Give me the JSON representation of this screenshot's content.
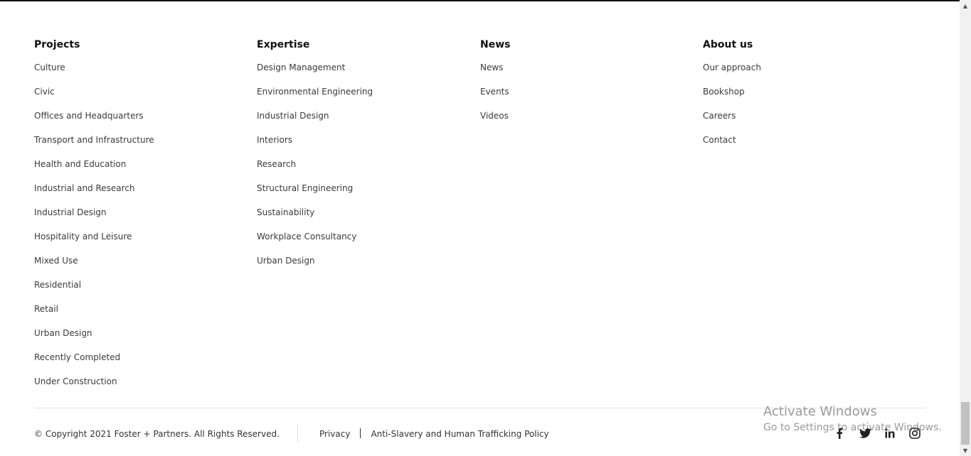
{
  "footer": {
    "columns": [
      {
        "heading": "Projects",
        "links": [
          "Culture",
          "Civic",
          "Offices and Headquarters",
          "Transport and Infrastructure",
          "Health and Education",
          "Industrial and Research",
          "Industrial Design",
          "Hospitality and Leisure",
          "Mixed Use",
          "Residential",
          "Retail",
          "Urban Design",
          "Recently Completed",
          "Under Construction"
        ]
      },
      {
        "heading": "Expertise",
        "links": [
          "Design Management",
          "Environmental Engineering",
          "Industrial Design",
          "Interiors",
          "Research",
          "Structural Engineering",
          "Sustainability",
          "Workplace Consultancy",
          "Urban Design"
        ]
      },
      {
        "heading": "News",
        "links": [
          "News",
          "Events",
          "Videos"
        ]
      },
      {
        "heading": "About us",
        "links": [
          "Our approach",
          "Bookshop",
          "Careers",
          "Contact"
        ]
      }
    ],
    "copyright": "© Copyright 2021 Foster + Partners. All Rights Reserved.",
    "legal_links": [
      "Privacy",
      "Anti-Slavery and Human Trafficking Policy"
    ],
    "social_icons": [
      "facebook-icon",
      "twitter-icon",
      "linkedin-icon",
      "instagram-icon"
    ]
  },
  "watermark": {
    "line1": "Activate Windows",
    "line2": "Go to Settings to activate Windows."
  }
}
